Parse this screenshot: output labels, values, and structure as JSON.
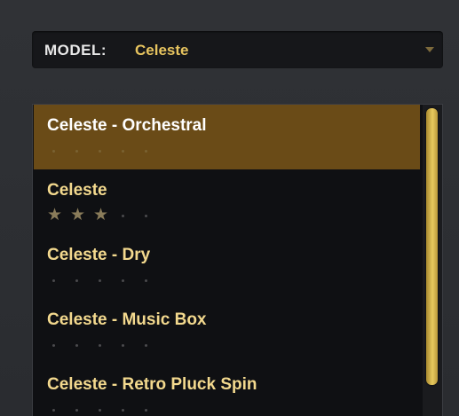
{
  "model": {
    "label": "MODEL:",
    "value": "Celeste",
    "arrow_icon": "triangle-down-icon"
  },
  "presets": {
    "items": [
      {
        "name": "Celeste - Orchestral",
        "rating": 0,
        "max_rating": 5,
        "selected": true
      },
      {
        "name": "Celeste",
        "rating": 3,
        "max_rating": 5,
        "selected": false
      },
      {
        "name": "Celeste - Dry",
        "rating": 0,
        "max_rating": 5,
        "selected": false
      },
      {
        "name": "Celeste - Music Box",
        "rating": 0,
        "max_rating": 5,
        "selected": false
      },
      {
        "name": "Celeste - Retro Pluck Spin",
        "rating": 0,
        "max_rating": 5,
        "selected": false
      }
    ],
    "star_glyph": "★"
  },
  "colors": {
    "accent": "#e7c45f",
    "selected_bg": "#6a4b17",
    "item_text": "#f3d98e",
    "selected_text": "#ffffff"
  }
}
